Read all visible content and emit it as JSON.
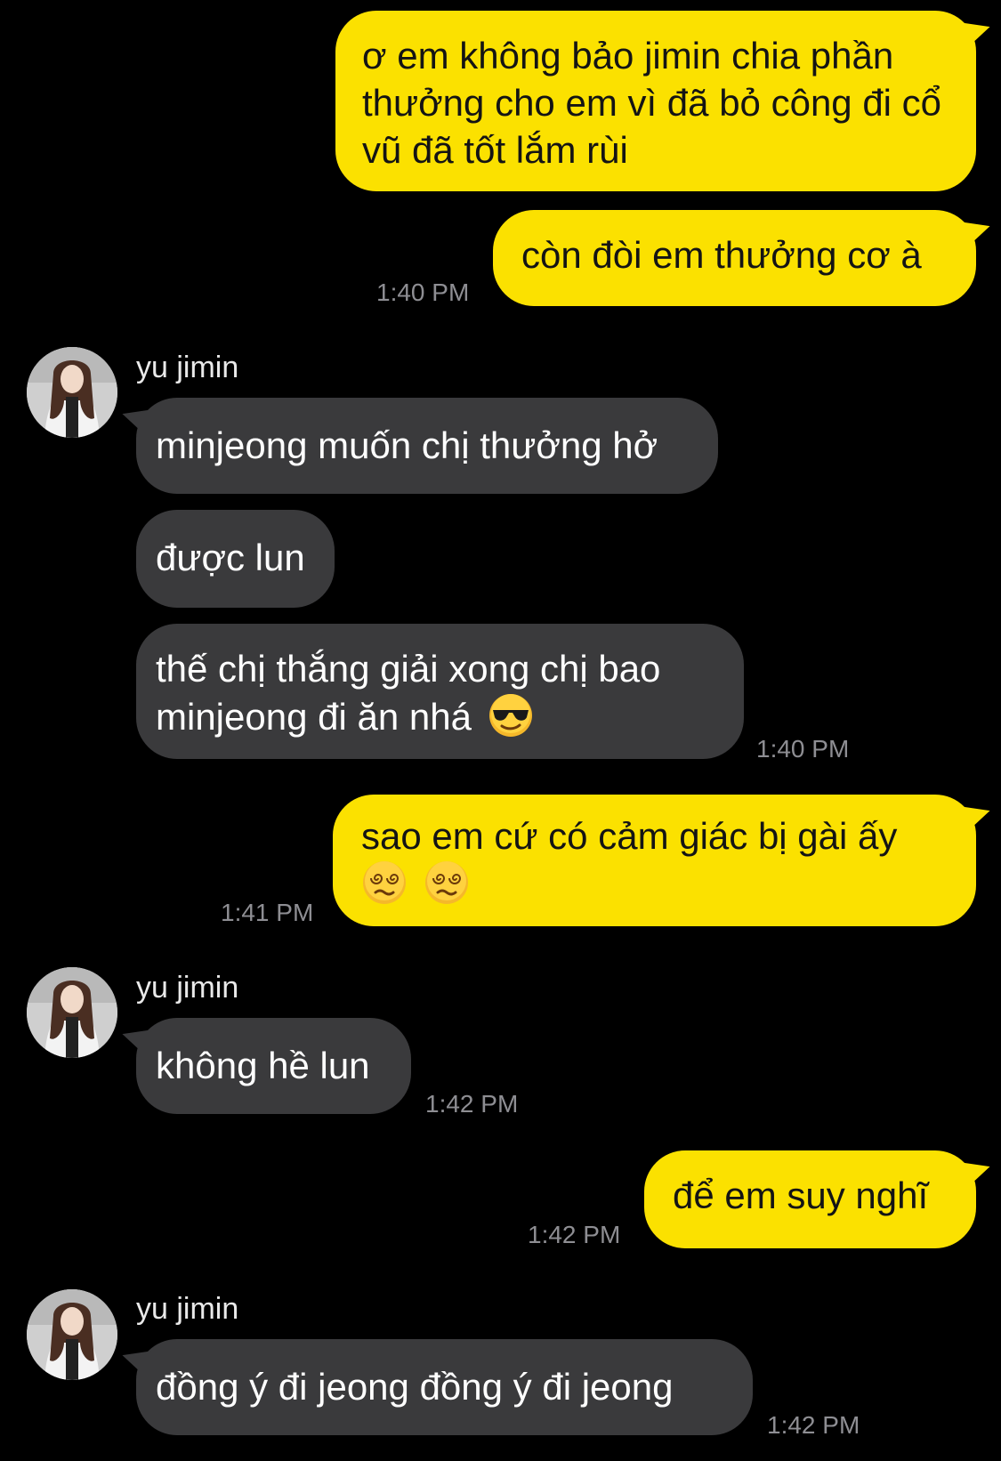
{
  "contact": {
    "name": "yu jimin"
  },
  "messages": [
    {
      "id": "m1",
      "from": "me",
      "text": "ơ em không bảo jimin chia phần thưởng cho em vì đã bỏ công đi cổ vũ đã tốt lắm rùi"
    },
    {
      "id": "m2",
      "from": "me",
      "text": "còn đòi em thưởng cơ à",
      "time": "1:40 PM"
    },
    {
      "id": "m3",
      "from": "yu jimin",
      "sender_label": "yu jimin",
      "text": "minjeong muốn chị thưởng hở"
    },
    {
      "id": "m4",
      "from": "yu jimin",
      "text": "được lun"
    },
    {
      "id": "m5",
      "from": "yu jimin",
      "text_line1": "thế chị thắng giải xong chị bao",
      "text_line2": "minjeong đi ăn nhá",
      "emoji": "sunglasses-emoji",
      "time": "1:40 PM"
    },
    {
      "id": "m6",
      "from": "me",
      "text": "sao em cứ có cảm giác bị gài ấy",
      "emoji": [
        "dizzy-face-emoji",
        "dizzy-face-emoji"
      ],
      "time": "1:41 PM"
    },
    {
      "id": "m7",
      "from": "yu jimin",
      "sender_label": "yu jimin",
      "text": "không hề lun",
      "time": "1:42 PM"
    },
    {
      "id": "m8",
      "from": "me",
      "text": "để em suy nghĩ",
      "time": "1:42 PM"
    },
    {
      "id": "m9",
      "from": "yu jimin",
      "sender_label": "yu jimin",
      "text": "đồng ý đi jeong đồng ý đi jeong",
      "time": "1:42 PM"
    }
  ],
  "colors": {
    "background": "#000000",
    "sent_bubble": "#fbe100",
    "received_bubble": "#3a3a3c",
    "timestamp": "#8e8e93"
  }
}
